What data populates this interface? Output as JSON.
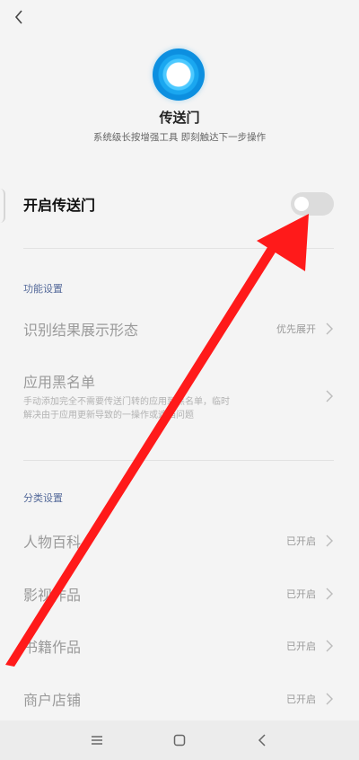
{
  "header": {
    "back_icon": "chevron-left-icon"
  },
  "app": {
    "logo_icon": "blue-ring-logo",
    "title": "传送门",
    "subtitle": "系统级长按增强工具 即刻触达下一步操作"
  },
  "main_toggle": {
    "label": "开启传送门",
    "enabled": false
  },
  "function_settings": {
    "header": "功能设置",
    "recognition_display": {
      "label": "识别结果展示形态",
      "value": "优先展开"
    },
    "blacklist": {
      "label": "应用黑名单",
      "description_line1": "手动添加完全不需要传送门转的应用到黑名单，临时",
      "description_line2": "解决由于应用更新导致的一操作或遮挡问题"
    }
  },
  "category_settings": {
    "header": "分类设置",
    "items": [
      {
        "label": "人物百科",
        "status": "已开启"
      },
      {
        "label": "影视作品",
        "status": "已开启"
      },
      {
        "label": "书籍作品",
        "status": "已开启"
      },
      {
        "label": "商户店铺",
        "status": "已开启"
      }
    ]
  },
  "nav_bar": {
    "menu_icon": "menu-icon",
    "home_icon": "home-square-icon",
    "back_icon": "back-triangle-icon"
  },
  "annotation": {
    "arrow_color": "#ff1a1a"
  },
  "colors": {
    "section_header": "#556a9a",
    "logo_blue": "#1aa7f0"
  }
}
